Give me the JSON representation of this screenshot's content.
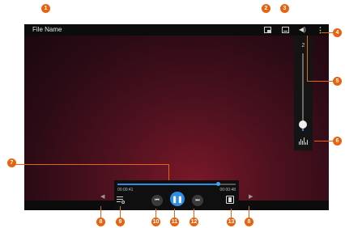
{
  "player": {
    "file_name": "File Name",
    "volume_level": "2",
    "volume_fraction": 0.08,
    "current_time": "00:00:41",
    "total_time": "00:00:48",
    "progress_fraction": 0.85,
    "prev_symbol": "⏮",
    "pause_symbol": "❚❚",
    "next_symbol": "⏭",
    "volume_symbol": "◀)",
    "more_symbol": "⋮",
    "left_arrow": "◀",
    "right_arrow": "▶"
  },
  "icons": [
    "popup-play-icon",
    "subtitles-icon",
    "volume-icon",
    "more-options-icon",
    "equalizer-icon",
    "playlist-icon",
    "rewind-icon",
    "pause-icon",
    "fast-forward-icon",
    "screen-size-icon"
  ],
  "callouts": [
    "1",
    "2",
    "3",
    "4",
    "5",
    "6",
    "7",
    "8",
    "9",
    "10",
    "11",
    "12",
    "13",
    "8"
  ],
  "colors": {
    "accent": "#2f8de4",
    "callout": "#e8620f",
    "background": "#4e111f"
  }
}
